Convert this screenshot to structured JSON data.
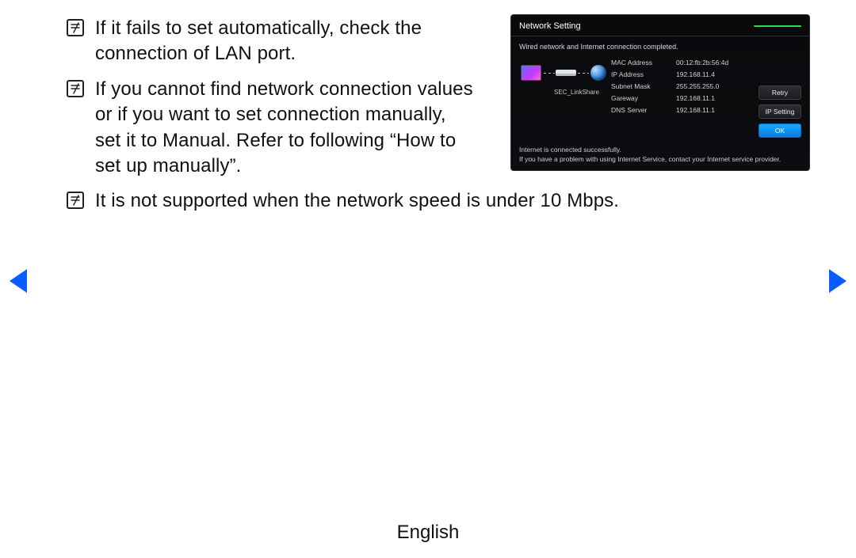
{
  "notes": [
    "If it fails to set automatically, check the connection of LAN port.",
    "If you cannot find network connection values or if you want to set connection manually, set it to Manual. Refer to following “How to set up manually”.",
    "It is not supported when the network speed is under 10 Mbps."
  ],
  "panel": {
    "title": "Network Setting",
    "status": "Wired network and Internet connection completed.",
    "sec_link": "SEC_LinkShare",
    "kv": {
      "mac_label": "MAC Address",
      "mac_value": "00:12:fb:2b:56:4d",
      "ip_label": "IP Address",
      "ip_value": "192.168.11.4",
      "subnet_label": "Subnet Mask",
      "subnet_value": "255.255.255.0",
      "gateway_label": "Gareway",
      "gateway_value": "192.168.11.1",
      "dns_label": "DNS Server",
      "dns_value": "192.168.11.1"
    },
    "buttons": {
      "retry": "Retry",
      "ipsetting": "IP Setting",
      "ok": "OK"
    },
    "foot1": "Internet is connected successfully.",
    "foot2": "If you have a problem with using Internet Service, contact your Internet service provider."
  },
  "language": "English"
}
